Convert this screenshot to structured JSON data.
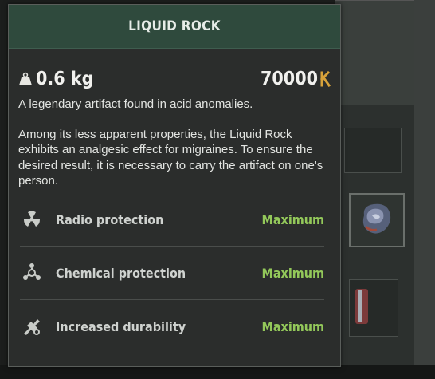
{
  "tooltip": {
    "title": "LIQUID ROCK",
    "weight": "0.6 kg",
    "price": "70000",
    "description": [
      "A legendary artifact found in acid anomalies.",
      "Among its less apparent properties, the Liquid Rock exhibits an analgesic effect for migraines. To ensure the desired result, it is necessary to carry the artifact on one's person."
    ],
    "properties": [
      {
        "icon": "radiation-icon",
        "label": "Radio protection",
        "value": "Maximum"
      },
      {
        "icon": "chemical-icon",
        "label": "Chemical protection",
        "value": "Maximum"
      },
      {
        "icon": "durability-icon",
        "label": "Increased durability",
        "value": "Maximum"
      }
    ]
  },
  "colors": {
    "header": "#2f4a3d",
    "value_green": "#93c85a",
    "panel": "#2b2d2c",
    "coupon": "#d8a23a"
  }
}
